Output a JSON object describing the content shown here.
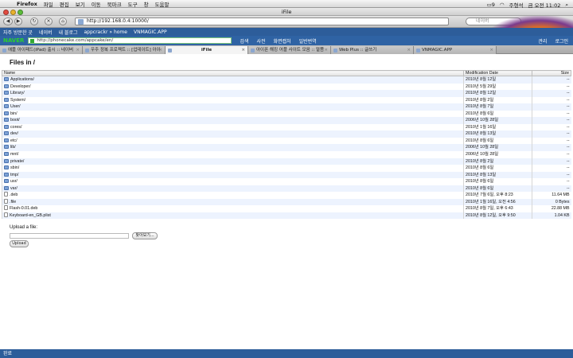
{
  "menubar": {
    "app": "Firefox",
    "items": [
      "파일",
      "편집",
      "보기",
      "이동",
      "북마크",
      "도구",
      "창",
      "도움말"
    ],
    "battery": "9",
    "user": "주형석",
    "clock": "금 오전 11:02"
  },
  "window": {
    "title": "iFile"
  },
  "nav": {
    "url": "http://192.168.0.4:10000/",
    "search_placeholder": "네이버"
  },
  "bookmarks": [
    "자주 방문한 곳",
    "네이버",
    "내 블로그",
    "appcrackr » home",
    "VNMAGIC.APP"
  ],
  "naver": {
    "logo": "NAVER",
    "search_value": "http://phonecake.com/appcake/en/",
    "search_btn": "검색",
    "buttons": [
      "사전",
      "화면캡처",
      "일반번역"
    ],
    "right": [
      "관리",
      "로그인"
    ]
  },
  "tabs": [
    {
      "label": "애플 아이패드(iPad) 출시 :: 네이버",
      "active": false
    },
    {
      "label": "우주 정복 프로젝트 :: [업데이트] 아이",
      "active": false
    },
    {
      "label": "iFile",
      "active": true
    },
    {
      "label": "아이폰 해킹 어플 사이트 모음 :: 멀쯤",
      "active": false
    },
    {
      "label": "Web Plus :: 글쓰기",
      "active": false
    },
    {
      "label": "VNMAGIC.APP",
      "active": false
    }
  ],
  "page": {
    "heading": "Files in /",
    "col_name": "Name",
    "col_date": "Modification Date",
    "col_size": "Size"
  },
  "files": [
    {
      "name": "Applications/",
      "date": "2010년 8월 12일",
      "size": "--",
      "type": "folder"
    },
    {
      "name": "Developer/",
      "date": "2010년 5월 29일",
      "size": "--",
      "type": "folder"
    },
    {
      "name": "Library/",
      "date": "2010년 8월 12일",
      "size": "--",
      "type": "folder"
    },
    {
      "name": "System/",
      "date": "2010년 8월 2일",
      "size": "--",
      "type": "folder"
    },
    {
      "name": "User/",
      "date": "2010년 8월 7일",
      "size": "--",
      "type": "folder"
    },
    {
      "name": "bin/",
      "date": "2010년 8월 6일",
      "size": "--",
      "type": "folder"
    },
    {
      "name": "boot/",
      "date": "2006년 10월 28일",
      "size": "--",
      "type": "folder"
    },
    {
      "name": "cores/",
      "date": "2010년 1월 16일",
      "size": "--",
      "type": "folder"
    },
    {
      "name": "dev/",
      "date": "2010년 8월 13일",
      "size": "--",
      "type": "folder"
    },
    {
      "name": "etc/",
      "date": "2010년 8월 6일",
      "size": "--",
      "type": "folder"
    },
    {
      "name": "lib/",
      "date": "2006년 10월 28일",
      "size": "--",
      "type": "folder"
    },
    {
      "name": "mnt/",
      "date": "2006년 10월 28일",
      "size": "--",
      "type": "folder"
    },
    {
      "name": "private/",
      "date": "2010년 8월 2일",
      "size": "--",
      "type": "folder"
    },
    {
      "name": "sbin/",
      "date": "2010년 8월 6일",
      "size": "--",
      "type": "folder"
    },
    {
      "name": "tmp/",
      "date": "2010년 8월 13일",
      "size": "--",
      "type": "folder"
    },
    {
      "name": "usr/",
      "date": "2010년 8월 6일",
      "size": "--",
      "type": "folder"
    },
    {
      "name": "var/",
      "date": "2010년 8월 6일",
      "size": "--",
      "type": "folder"
    },
    {
      "name": ".deb",
      "date": "2010년 7월 6일, 오후 8:23",
      "size": "11.64 MB",
      "type": "file"
    },
    {
      "name": ".file",
      "date": "2010년 1월 16일, 오전 4:56",
      "size": "0 Bytes",
      "type": "file"
    },
    {
      "name": "Flash-0.01.deb",
      "date": "2010년 8월 7일, 오후 6:43",
      "size": "22.88 MB",
      "type": "file"
    },
    {
      "name": "Keyboard-en_GB.plist",
      "date": "2010년 8월 12일, 오후 9:50",
      "size": "1.04 KB",
      "type": "file"
    }
  ],
  "upload": {
    "label": "Upload a file:",
    "browse": "찾아보기...",
    "button": "Upload"
  },
  "status": {
    "text": "완료"
  }
}
